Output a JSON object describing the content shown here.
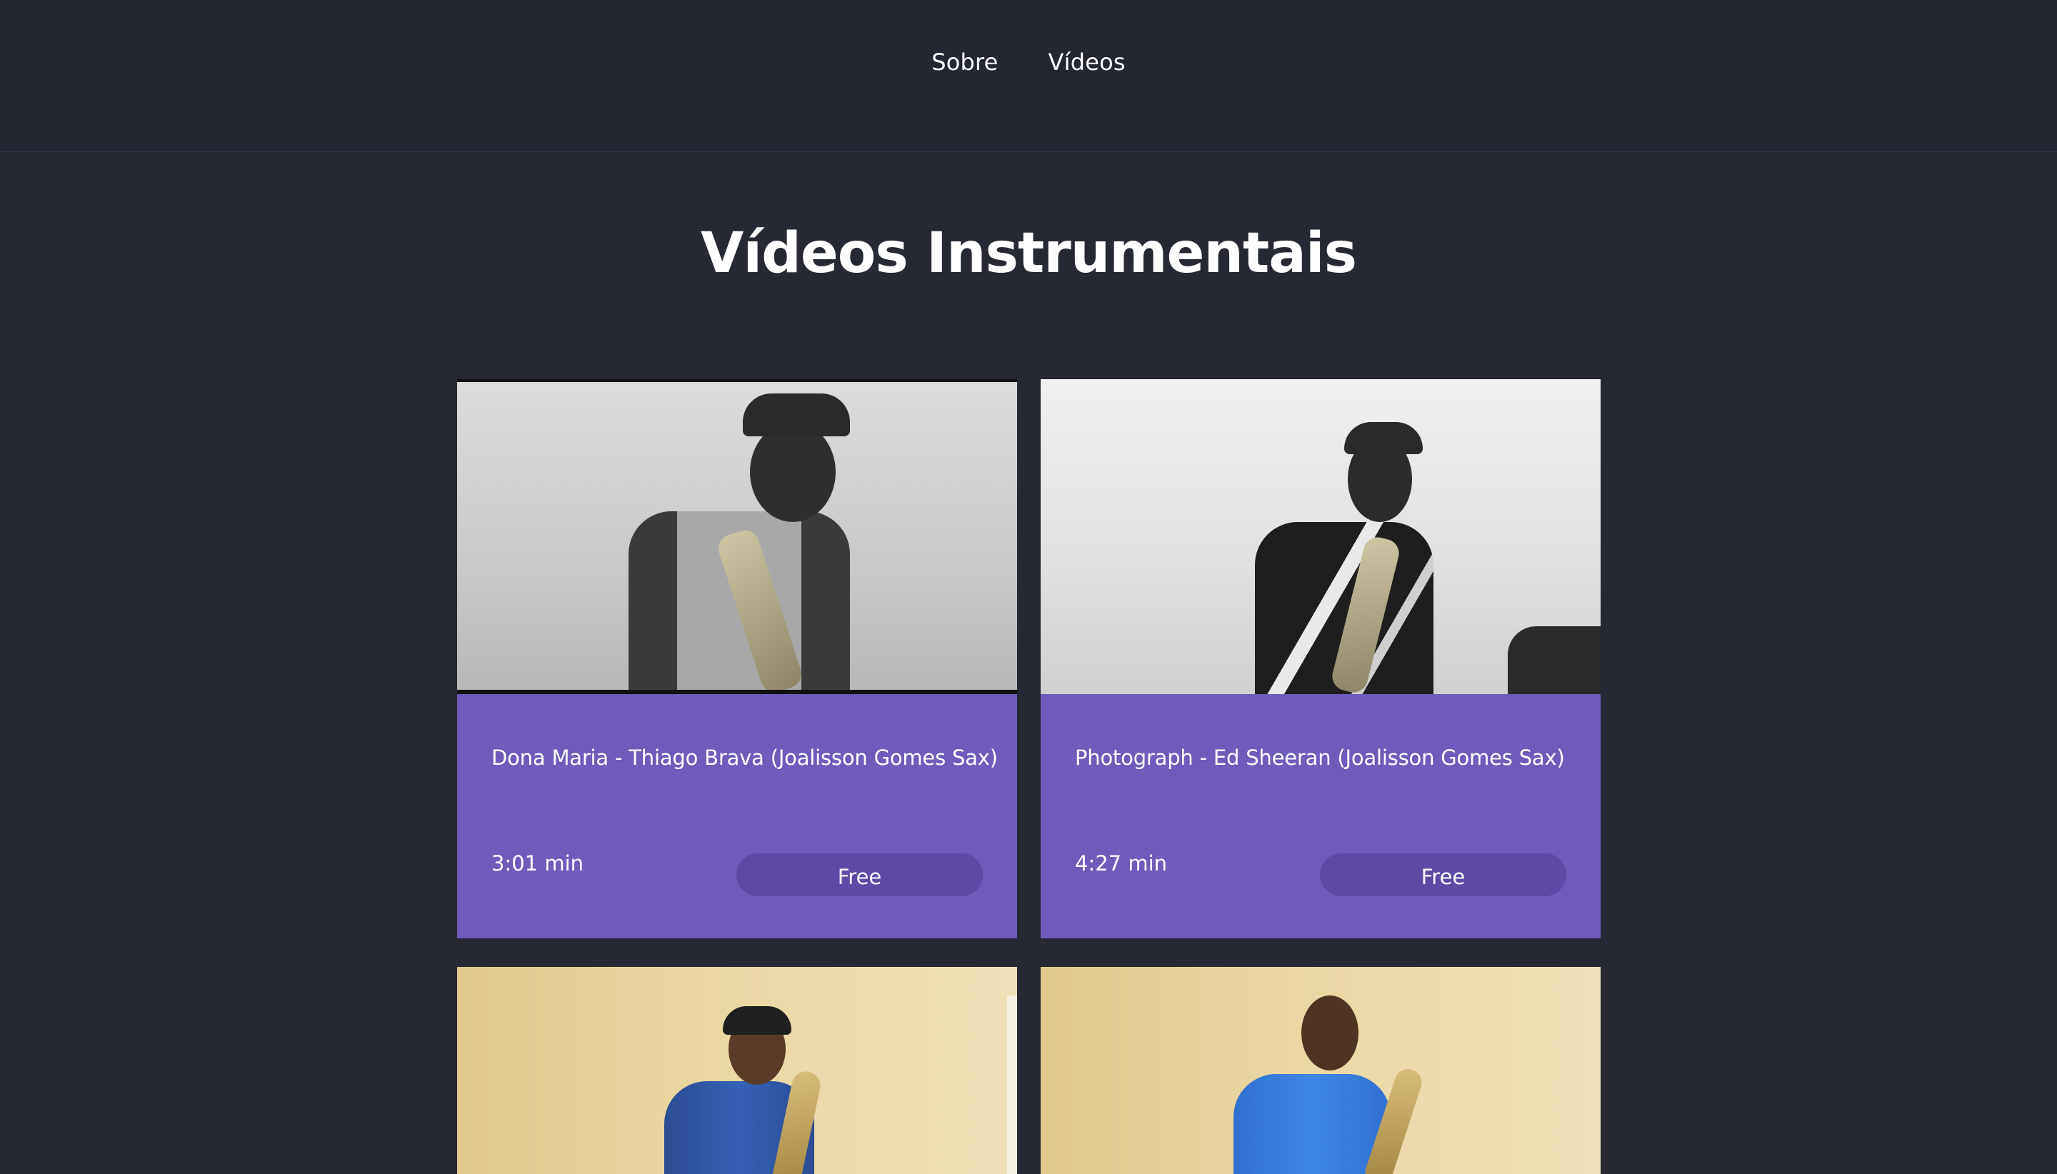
{
  "nav": {
    "items": [
      "Sobre",
      "Vídeos"
    ]
  },
  "page": {
    "title": "Vídeos Instrumentais"
  },
  "videos": [
    {
      "title": "Dona Maria - Thiago Brava (Joalisson Gomes Sax)",
      "duration": "3:01 min",
      "price": "Free"
    },
    {
      "title": "Photograph - Ed Sheeran (Joalisson Gomes Sax)",
      "duration": "4:27 min",
      "price": "Free"
    },
    {
      "title": "",
      "duration": "",
      "price": ""
    },
    {
      "title": "",
      "duration": "",
      "price": ""
    }
  ],
  "colors": {
    "background": "#262834",
    "card": "#6f5bbb",
    "button": "#5d4aa6"
  }
}
